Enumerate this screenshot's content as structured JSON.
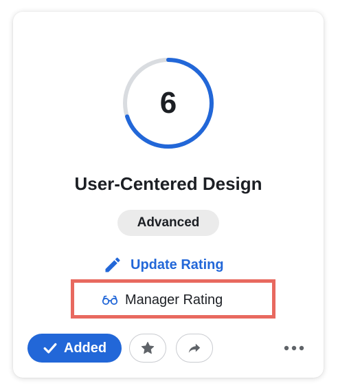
{
  "skill_card": {
    "rating_value": "6",
    "rating_fraction": 0.7,
    "title": "User-Centered Design",
    "level_badge": "Advanced",
    "update_rating_label": "Update Rating",
    "manager_rating_label": "Manager Rating",
    "added_label": "Added",
    "icons": {
      "update": "pencil-icon",
      "manager": "glasses-icon",
      "added": "checkmark-icon",
      "favorite": "star-icon",
      "share": "share-icon",
      "more": "more-horizontal-icon"
    }
  },
  "colors": {
    "accent": "#2267d8",
    "ring_track": "#d9dce0",
    "highlight_border": "#e8695f",
    "badge_background": "#ebebeb",
    "text": "#1c1f24"
  }
}
